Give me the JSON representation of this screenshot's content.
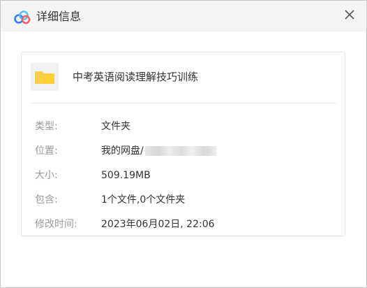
{
  "window": {
    "title": "详细信息",
    "app_icon": "baidu-netdisk-cloud-icon",
    "close_icon": "close-icon"
  },
  "file": {
    "icon": "folder-icon",
    "name": "中考英语阅读理解技巧训练"
  },
  "details": {
    "type_label": "类型:",
    "type_value": "文件夹",
    "location_label": "位置:",
    "location_value": "我的网盘/",
    "size_label": "大小:",
    "size_value": "509.19MB",
    "contains_label": "包含:",
    "contains_value": "1个文件,0个文件夹",
    "modified_label": "修改时间:",
    "modified_value": "2023年06月02日, 22:06"
  },
  "colors": {
    "titlebar_bg": "#f4f4f6",
    "folder_yellow": "#ffd24d",
    "label_gray": "#999999",
    "text_dark": "#333333"
  }
}
